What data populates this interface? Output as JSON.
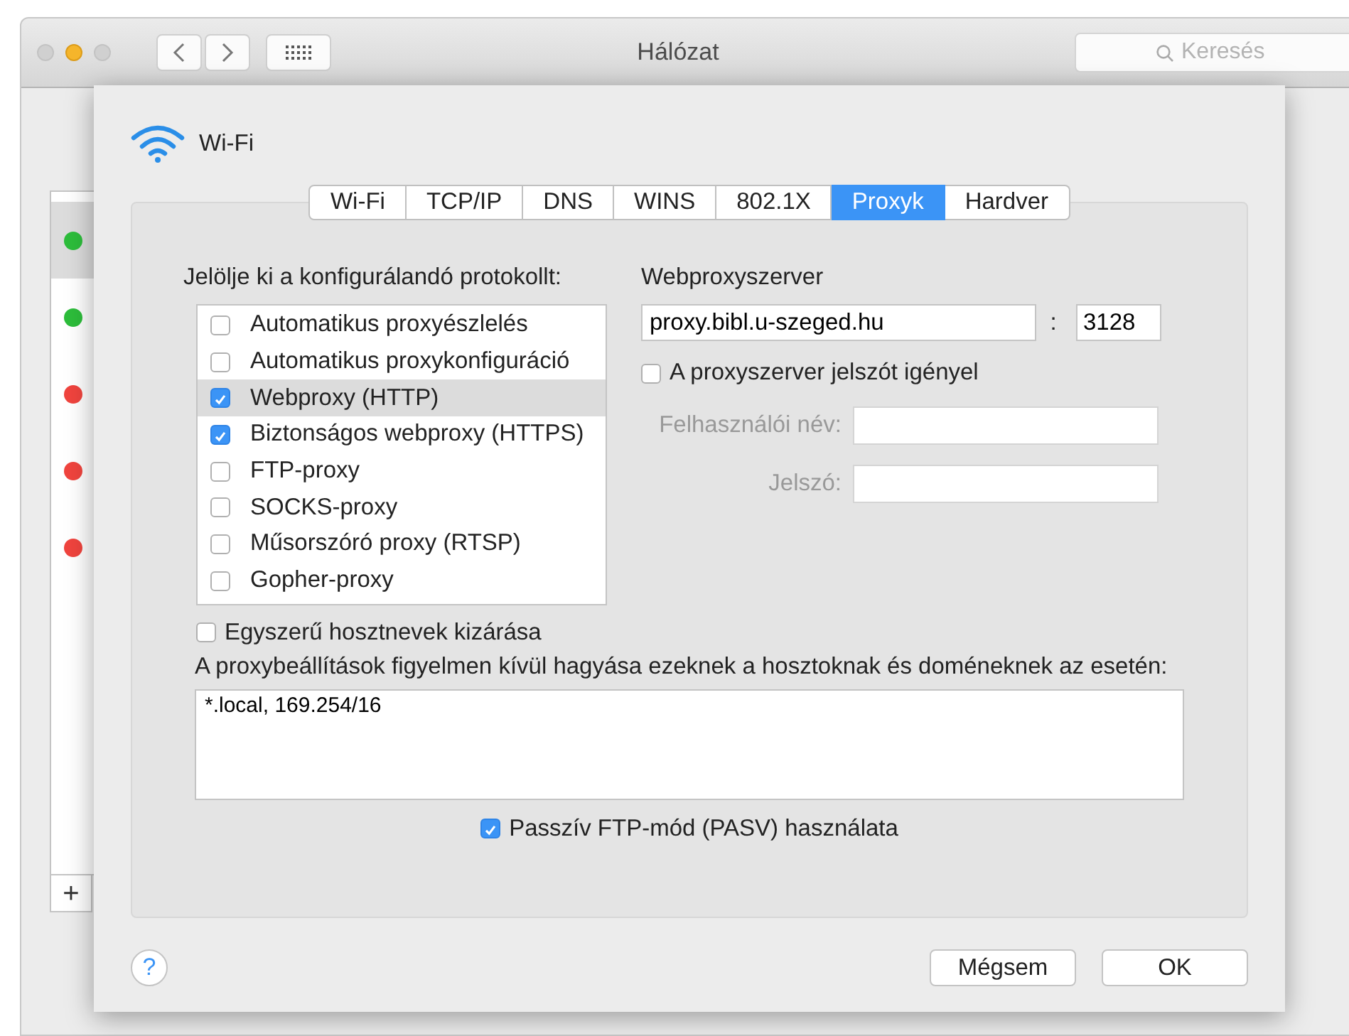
{
  "window": {
    "title": "Hálózat",
    "search": {
      "placeholder": "Keresés"
    }
  },
  "services": [
    {
      "color": "#2dbd3b",
      "selected": true
    },
    {
      "color": "#2dbd3b",
      "selected": false
    },
    {
      "color": "#f0443e",
      "selected": false
    },
    {
      "color": "#f0443e",
      "selected": false
    },
    {
      "color": "#f0443e",
      "selected": false
    }
  ],
  "add_button": "+",
  "sheet": {
    "interface": "Wi-Fi",
    "tabs": [
      {
        "label": "Wi-Fi",
        "selected": false
      },
      {
        "label": "TCP/IP",
        "selected": false
      },
      {
        "label": "DNS",
        "selected": false
      },
      {
        "label": "WINS",
        "selected": false
      },
      {
        "label": "802.1X",
        "selected": false
      },
      {
        "label": "Proxyk",
        "selected": true
      },
      {
        "label": "Hardver",
        "selected": false
      }
    ],
    "protocols": {
      "label": "Jelölje ki a konfigurálandó protokollt:",
      "items": [
        {
          "label": "Automatikus proxyészlelés",
          "checked": false,
          "selected": false
        },
        {
          "label": "Automatikus proxykonfiguráció",
          "checked": false,
          "selected": false
        },
        {
          "label": "Webproxy (HTTP)",
          "checked": true,
          "selected": true
        },
        {
          "label": "Biztonságos webproxy (HTTPS)",
          "checked": true,
          "selected": false
        },
        {
          "label": "FTP-proxy",
          "checked": false,
          "selected": false
        },
        {
          "label": "SOCKS-proxy",
          "checked": false,
          "selected": false
        },
        {
          "label": "Műsorszóró proxy (RTSP)",
          "checked": false,
          "selected": false
        },
        {
          "label": "Gopher-proxy",
          "checked": false,
          "selected": false
        }
      ]
    },
    "server": {
      "label": "Webproxyszerver",
      "host": "proxy.bibl.u-szeged.hu",
      "separator": ":",
      "port": "3128",
      "password_required": {
        "label": "A proxyszerver jelszót igényel",
        "checked": false
      },
      "credentials": [
        {
          "label": "Felhasználói név:",
          "disabled": true
        },
        {
          "label": "Jelszó:",
          "disabled": true
        }
      ]
    },
    "exclude_simple": {
      "label": "Egyszerű hosztnevek kizárása",
      "checked": false
    },
    "bypass": {
      "label": "A proxybeállítások figyelmen kívül hagyása ezeknek a hosztoknak és doméneknek az esetén:",
      "value": "*.local, 169.254/16"
    },
    "pasv": {
      "label": "Passzív FTP-mód (PASV) használata",
      "checked": true
    },
    "help": "?",
    "buttons": [
      "Mégsem",
      "OK"
    ]
  }
}
